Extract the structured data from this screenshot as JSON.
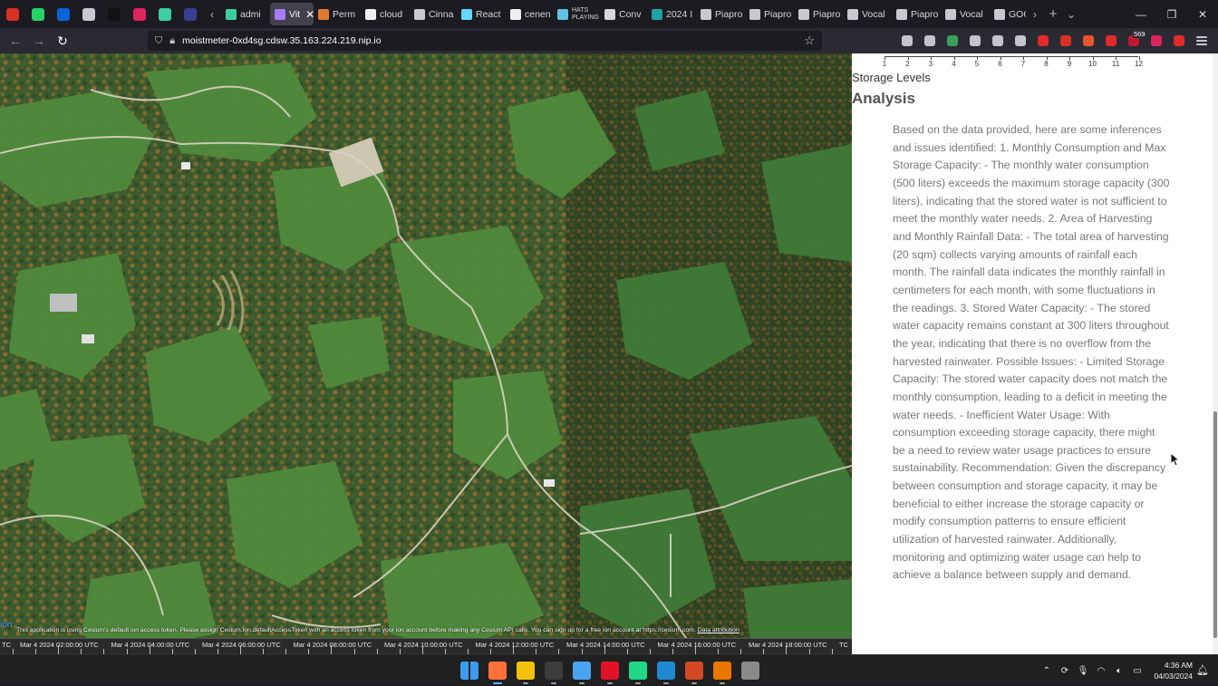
{
  "browser": {
    "pinned_icons": [
      {
        "name": "gmail-icon",
        "color": "#d93025"
      },
      {
        "name": "whatsapp-icon",
        "color": "#25d366"
      },
      {
        "name": "outlook-icon",
        "color": "#0a64d8"
      },
      {
        "name": "piapro-icon",
        "color": "#c8c8d0"
      },
      {
        "name": "circle-app-icon",
        "color": "#111111"
      },
      {
        "name": "container-icon",
        "color": "#e0245e"
      },
      {
        "name": "grid-app-icon",
        "color": "#3ecfa0"
      },
      {
        "name": "linear-icon",
        "color": "#3b3f8f"
      }
    ],
    "tabs": [
      {
        "label": "admi",
        "icon": "grid-app-icon",
        "color": "#3ecfa0",
        "active": false
      },
      {
        "label": "Vit",
        "icon": "vite-icon",
        "color": "#a87bff",
        "active": true
      },
      {
        "label": "Perm",
        "icon": "flag-icon",
        "color": "#e07a2e",
        "active": false
      },
      {
        "label": "cloud",
        "icon": "github-icon",
        "color": "#f0f0f0",
        "active": false
      },
      {
        "label": "Cinna",
        "icon": "piapro-icon",
        "color": "#c8c8d0",
        "active": false
      },
      {
        "label": "React",
        "icon": "react-icon",
        "color": "#61dafb",
        "active": false
      },
      {
        "label": "cenen",
        "icon": "github-icon",
        "color": "#f0f0f0",
        "active": false
      },
      {
        "label": "HATS PLAYING",
        "icon": "hats-icon",
        "color": "#5fc3e4",
        "active": false
      },
      {
        "label": "Conv",
        "icon": "info-icon",
        "color": "#d7d6dc",
        "active": false
      },
      {
        "label": "2024 I",
        "icon": "globe-icon",
        "color": "#1fa3a3",
        "active": false
      },
      {
        "label": "Piapro",
        "icon": "piapro-icon",
        "color": "#c8c8d0",
        "active": false
      },
      {
        "label": "Piapro",
        "icon": "piapro-icon",
        "color": "#c8c8d0",
        "active": false
      },
      {
        "label": "Piapro",
        "icon": "piapro-icon",
        "color": "#c8c8d0",
        "active": false
      },
      {
        "label": "Vocal",
        "icon": "piapro-icon",
        "color": "#c8c8d0",
        "active": false
      },
      {
        "label": "Piapro",
        "icon": "piapro-icon",
        "color": "#c8c8d0",
        "active": false
      },
      {
        "label": "Vocal",
        "icon": "piapro-icon",
        "color": "#c8c8d0",
        "active": false
      },
      {
        "label": "GOO",
        "icon": "piapro-icon",
        "color": "#c8c8d0",
        "active": false
      }
    ],
    "url": "moistmeter-0xd4sg.cdsw.35.163.224.219.nip.io",
    "extension_badge": "569",
    "extensions": [
      {
        "name": "pocket-icon",
        "color": "#c5c4cc"
      },
      {
        "name": "download-icon",
        "color": "#c5c4cc"
      },
      {
        "name": "green-extension-icon",
        "color": "#3aa05a"
      },
      {
        "name": "extensions-icon",
        "color": "#c5c4cc"
      },
      {
        "name": "chat-icon",
        "color": "#c5c4cc"
      },
      {
        "name": "dark-mode-icon",
        "color": "#c5c4cc"
      },
      {
        "name": "red-extension-icon",
        "color": "#e02b2b"
      },
      {
        "name": "record-icon",
        "color": "#d93025"
      },
      {
        "name": "screenshot-icon",
        "color": "#e8542b"
      },
      {
        "name": "lock-extension-icon",
        "color": "#e02b2b"
      },
      {
        "name": "ublock-icon",
        "color": "#c0182e"
      },
      {
        "name": "b-extension-icon",
        "color": "#e0245e"
      },
      {
        "name": "heart-extension-icon",
        "color": "#e02b2b"
      },
      {
        "name": "menu-icon",
        "color": "#c5c4cc"
      }
    ]
  },
  "map": {
    "credit_prefix": "ion",
    "credit_text": "This application is using Cesium's default ion access token. Please assign Cesium.Ion.defaultAccessToken with an access token from your ion account before making any Cesium API calls. You can sign up for a free ion account at https://cesium.com.",
    "credit_link": "Data attribution",
    "timeline_start": "TC",
    "timeline_labels": [
      "Mar 4 2024 02:00:00 UTC",
      "Mar 4 2024 04:00:00 UTC",
      "Mar 4 2024 06:00:00 UTC",
      "Mar 4 2024 08:00:00 UTC",
      "Mar 4 2024 10:00:00 UTC",
      "Mar 4 2024 12:00:00 UTC",
      "Mar 4 2024 14:00:00 UTC",
      "Mar 4 2024 16:00:00 UTC",
      "Mar 4 2024 18:00:00 UTC"
    ],
    "timeline_end": "TC"
  },
  "panel": {
    "axis_ticks": [
      "1",
      "2",
      "3",
      "4",
      "5",
      "6",
      "7",
      "8",
      "9",
      "10",
      "11",
      "12"
    ],
    "chart_caption": "Storage Levels",
    "analysis_title": "Analysis",
    "analysis_text": "Based on the data provided, here are some inferences and issues identified: 1. Monthly Consumption and Max Storage Capacity: - The monthly water consumption (500 liters) exceeds the maximum storage capacity (300 liters), indicating that the stored water is not sufficient to meet the monthly water needs. 2. Area of Harvesting and Monthly Rainfall Data: - The total area of harvesting (20 sqm) collects varying amounts of rainfall each month. The rainfall data indicates the monthly rainfall in centimeters for each month, with some fluctuations in the readings. 3. Stored Water Capacity: - The stored water capacity remains constant at 300 liters throughout the year, indicating that there is no overflow from the harvested rainwater. Possible Issues: - Limited Storage Capacity: The stored water capacity does not match the monthly consumption, leading to a deficit in meeting the water needs. - Inefficient Water Usage: With consumption exceeding storage capacity, there might be a need to review water usage practices to ensure sustainability. Recommendation: Given the discrepancy between consumption and storage capacity, it may be beneficial to either increase the storage capacity or modify consumption patterns to ensure efficient utilization of harvested rainwater. Additionally, monitoring and optimizing water usage can help to achieve a balance between supply and demand."
  },
  "taskbar": {
    "apps": [
      {
        "name": "start-icon",
        "color": "#3a9bf0"
      },
      {
        "name": "firefox-icon",
        "color": "#ff7139"
      },
      {
        "name": "file-explorer-icon",
        "color": "#f4c20d"
      },
      {
        "name": "terminal-icon",
        "color": "#3c3c3c"
      },
      {
        "name": "notepad-icon",
        "color": "#4aa3f0"
      },
      {
        "name": "opera-icon",
        "color": "#e0122a"
      },
      {
        "name": "pycharm-icon",
        "color": "#21d789"
      },
      {
        "name": "vscode-icon",
        "color": "#1f8ad2"
      },
      {
        "name": "powerpoint-icon",
        "color": "#d24726"
      },
      {
        "name": "blender-icon",
        "color": "#ea7600"
      },
      {
        "name": "settings-icon",
        "color": "#8a8a8a"
      }
    ],
    "time": "4:36 AM",
    "date": "04/03/2024"
  }
}
